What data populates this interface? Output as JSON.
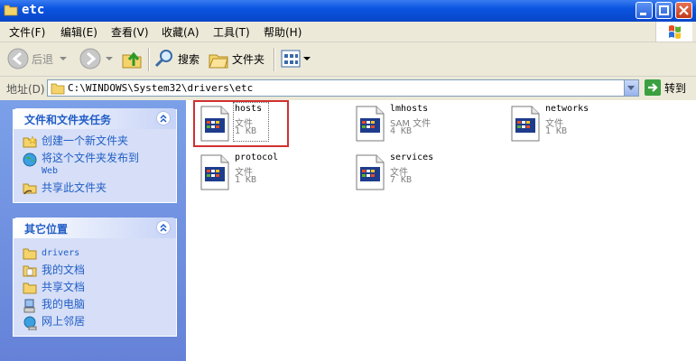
{
  "window": {
    "title": "etc"
  },
  "menu": {
    "items": [
      {
        "label": "文件(F)"
      },
      {
        "label": "编辑(E)"
      },
      {
        "label": "查看(V)"
      },
      {
        "label": "收藏(A)"
      },
      {
        "label": "工具(T)"
      },
      {
        "label": "帮助(H)"
      }
    ]
  },
  "toolbar": {
    "back_label": "后退",
    "search_label": "搜索",
    "folders_label": "文件夹"
  },
  "address": {
    "label": "地址(D)",
    "path": "C:\\WINDOWS\\System32\\drivers\\etc",
    "go_label": "转到"
  },
  "sidebar": {
    "tasks": {
      "title": "文件和文件夹任务",
      "items": [
        {
          "label": "创建一个新文件夹"
        },
        {
          "label": "将这个文件夹发布到",
          "label2": "Web"
        },
        {
          "label": "共享此文件夹"
        }
      ]
    },
    "places": {
      "title": "其它位置",
      "items": [
        {
          "label": "drivers"
        },
        {
          "label": "我的文档"
        },
        {
          "label": "共享文档"
        },
        {
          "label": "我的电脑"
        },
        {
          "label": "网上邻居"
        }
      ]
    }
  },
  "files": [
    {
      "name": "hosts",
      "type": "文件",
      "size": "1 KB",
      "selected": true
    },
    {
      "name": "lmhosts",
      "type": "SAM 文件",
      "size": "4 KB"
    },
    {
      "name": "networks",
      "type": "文件",
      "size": "1 KB"
    },
    {
      "name": "protocol",
      "type": "文件",
      "size": "1 KB"
    },
    {
      "name": "services",
      "type": "文件",
      "size": "7 KB"
    }
  ],
  "colors": {
    "title_bar": "#0a54e0",
    "sidebar_bg": "#6f8fdc",
    "panel_link": "#215dc6",
    "selection_highlight": "#d23030"
  }
}
